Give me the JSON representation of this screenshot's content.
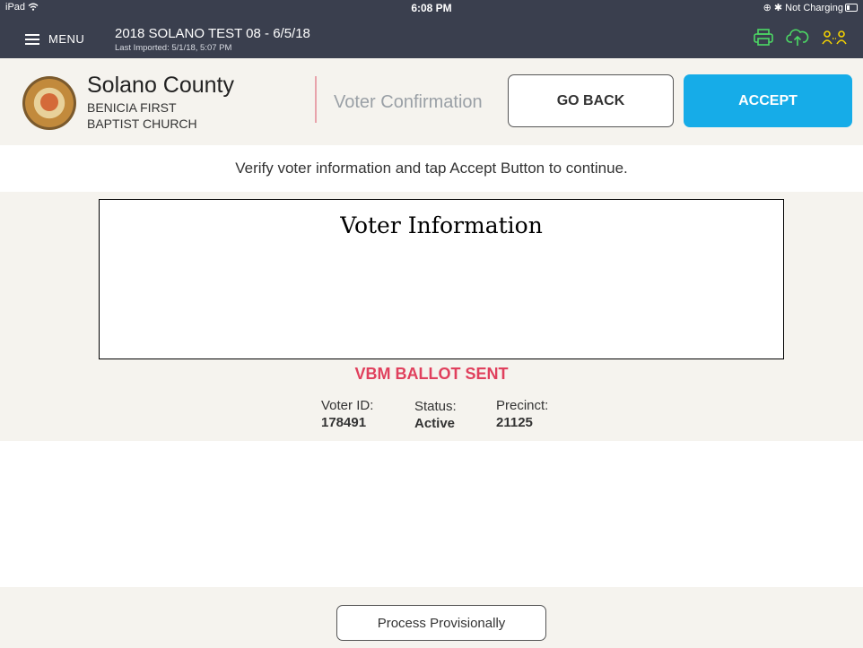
{
  "status_bar": {
    "device": "iPad",
    "time": "6:08 PM",
    "charging": "Not Charging"
  },
  "app_bar": {
    "menu_label": "MENU",
    "title": "2018 SOLANO TEST 08 - 6/5/18",
    "last_imported": "Last Imported: 5/1/18, 5:07 PM",
    "icons": [
      "printer-icon",
      "cloud-upload-icon",
      "users-sync-icon"
    ],
    "icon_colors": {
      "printer": "#4cd964",
      "cloud": "#4cd964",
      "users": "#f5d300"
    }
  },
  "header": {
    "county": "Solano County",
    "site_line1": "BENICIA FIRST",
    "site_line2": "BAPTIST CHURCH",
    "page_name": "Voter Confirmation",
    "go_back_label": "GO BACK",
    "accept_label": "ACCEPT",
    "accent_color": "#16ace8"
  },
  "instruction": "Verify voter information and tap Accept Button to continue.",
  "voter": {
    "info_title": "Voter Information",
    "ballot_status": "VBM BALLOT SENT",
    "voter_id_label": "Voter ID:",
    "voter_id": "178491",
    "status_label": "Status:",
    "status": "Active",
    "precinct_label": "Precinct:",
    "precinct": "21125"
  },
  "footer": {
    "process_label": "Process Provisionally"
  }
}
